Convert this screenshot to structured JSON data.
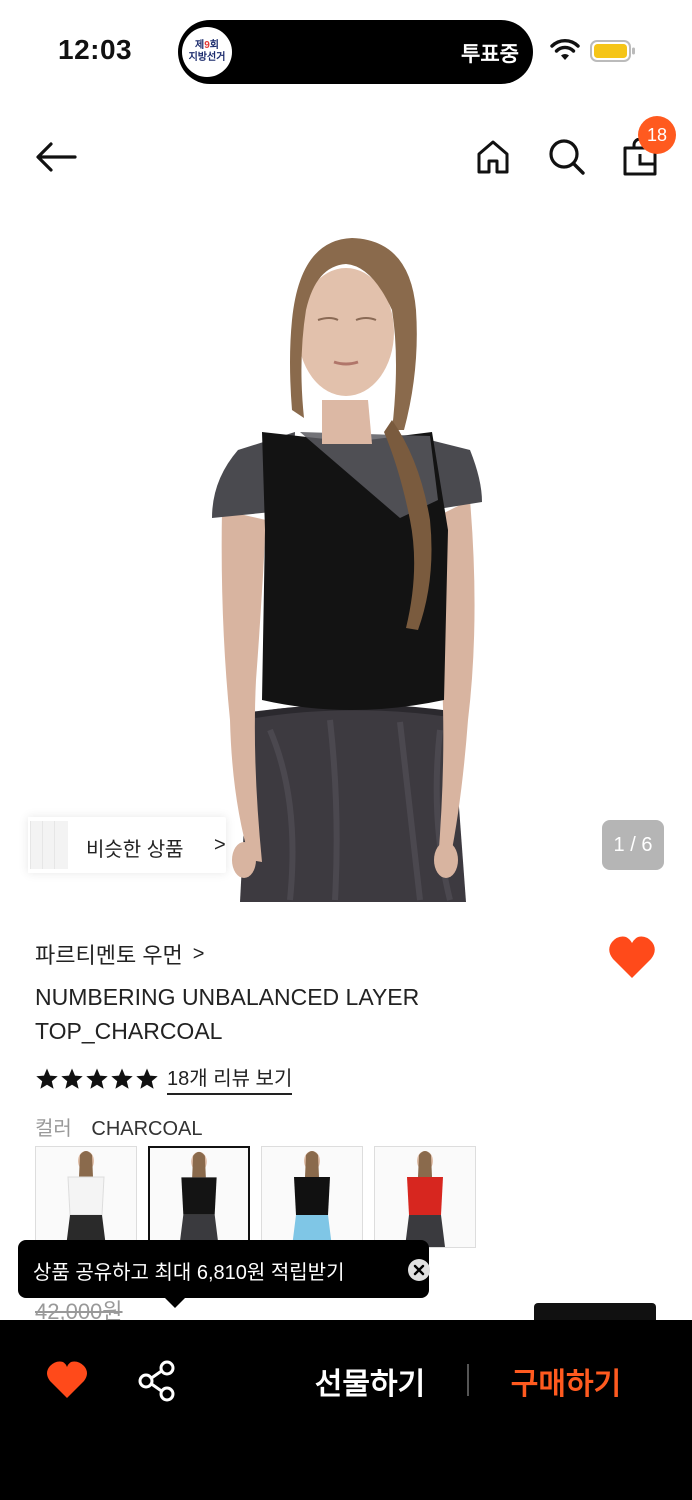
{
  "status_bar": {
    "time": "12:03",
    "election_badge": {
      "line1_prefix": "제",
      "line1_num": "9",
      "line1_suffix": "회",
      "line2": "지방선거"
    },
    "vote_status": "투표중"
  },
  "header": {
    "cart_count": "18",
    "icons": [
      "back-arrow-icon",
      "home-icon",
      "search-icon",
      "shopping-bag-icon"
    ]
  },
  "gallery": {
    "similar_label": "비슷한 상품",
    "similar_chevron": ">",
    "page_indicator": "1 / 6"
  },
  "product": {
    "brand": "파르티멘토 우먼",
    "brand_chevron": ">",
    "title": "NUMBERING UNBALANCED LAYER TOP_CHARCOAL",
    "rating": 5,
    "review_link": "18개 리뷰 보기",
    "color_label": "컬러",
    "color_value": "CHARCOAL",
    "swatches": [
      {
        "color": "white",
        "top_hex": "#f4f4f4",
        "bottom_hex": "#2a2a2a",
        "selected": false
      },
      {
        "color": "charcoal",
        "top_hex": "#141414",
        "bottom_hex": "#3a3a3e",
        "selected": true
      },
      {
        "color": "black",
        "top_hex": "#111111",
        "bottom_hex": "#7fc6e6",
        "selected": false
      },
      {
        "color": "red",
        "top_hex": "#d7261f",
        "bottom_hex": "#3a3a3e",
        "selected": false
      }
    ],
    "original_price": "42,000원",
    "wishlisted": true
  },
  "tooltip": {
    "text": "상품 공유하고 최대 6,810원 적립받기"
  },
  "bottom_bar": {
    "gift_label": "선물하기",
    "buy_label": "구매하기"
  },
  "colors": {
    "accent": "#ff5a1f",
    "heart": "#ff4a1a",
    "bar": "#000000"
  }
}
